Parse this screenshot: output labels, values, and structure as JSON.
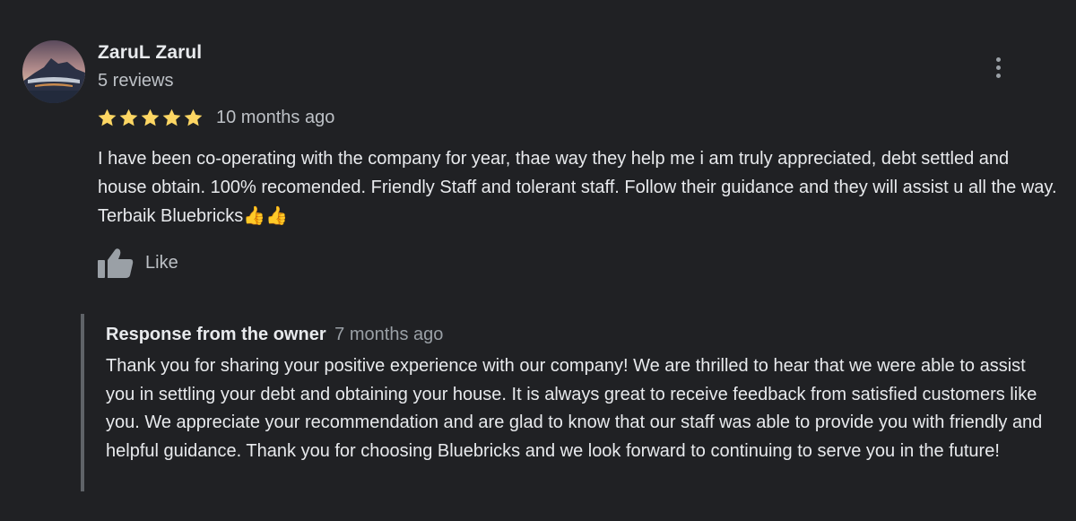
{
  "reviewer": {
    "name": "ZaruL Zarul",
    "review_count": "5 reviews"
  },
  "review": {
    "rating": 5,
    "max_rating": 5,
    "time": "10 months ago",
    "text": "I have been co-operating with the company for year, thae way they help me i am truly appreciated, debt settled and house obtain. 100% recomended. Friendly Staff and tolerant staff. Follow their guidance and they will assist u all the way. Terbaik Bluebricks👍👍",
    "like_label": "Like"
  },
  "response": {
    "title": "Response from the owner",
    "time": "7 months ago",
    "text": "Thank you for sharing your positive experience with our company! We are thrilled to hear that we were able to assist you in settling your debt and obtaining your house. It is always great to receive feedback from satisfied customers like you. We appreciate your recommendation and are glad to know that our staff was able to provide you with friendly and helpful guidance. Thank you for choosing Bluebricks and we look forward to continuing to serve you in the future!"
  },
  "icons": {
    "more": "more-vert-icon",
    "star": "star-icon",
    "like": "thumb-up-icon"
  },
  "colors": {
    "background": "#202124",
    "star": "#fdd663",
    "primary_text": "#e8eaed",
    "secondary_text": "#bdc1c6",
    "response_border": "#5f6368"
  }
}
